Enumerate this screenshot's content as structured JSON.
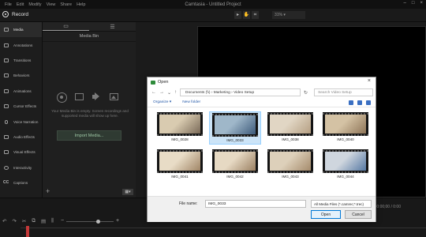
{
  "menubar": {
    "items": [
      "File",
      "Edit",
      "Modify",
      "View",
      "Share",
      "Help"
    ],
    "title": "Camtasia - Untitled Project"
  },
  "recordbar": {
    "record_label": "Record",
    "zoom": "31%"
  },
  "sidebar": {
    "items": [
      {
        "label": "Media",
        "icon": "media-icon"
      },
      {
        "label": "Annotations",
        "icon": "annotations-icon"
      },
      {
        "label": "Transitions",
        "icon": "transitions-icon"
      },
      {
        "label": "Behaviors",
        "icon": "behaviors-icon"
      },
      {
        "label": "Animations",
        "icon": "animations-icon"
      },
      {
        "label": "Cursor Effects",
        "icon": "cursor-effects-icon"
      },
      {
        "label": "Voice Narration",
        "icon": "microphone-icon"
      },
      {
        "label": "Audio Effects",
        "icon": "audio-effects-icon"
      },
      {
        "label": "Visual Effects",
        "icon": "visual-effects-icon"
      },
      {
        "label": "Interactivity",
        "icon": "interactivity-icon"
      },
      {
        "label": "Captions",
        "icon": "captions-icon"
      }
    ]
  },
  "panel": {
    "title": "Media Bin",
    "empty_message": "Your Media Bin is empty. Screen recordings and supported media will show up here.",
    "import_label": "Import Media..."
  },
  "timeline": {
    "timecode": "0:00:00;00 / 0:00"
  },
  "dialog": {
    "title": "Open",
    "address": "Documents (\\\\) › Marketing › Video Setup",
    "search_placeholder": "Search Video Setup",
    "organize_label": "Organize ▾",
    "new_folder_label": "New folder",
    "files": [
      {
        "name": "IMG_0028",
        "c1": "#d9cbb0",
        "c2": "#7a6a58",
        "selected": false
      },
      {
        "name": "IMG_0033",
        "c1": "#9fb7c9",
        "c2": "#3d5a7a",
        "selected": true
      },
      {
        "name": "IMG_0038",
        "c1": "#e1d6c4",
        "c2": "#b59f83",
        "selected": false
      },
      {
        "name": "IMG_0040",
        "c1": "#d4c2a4",
        "c2": "#8e7558",
        "selected": false
      },
      {
        "name": "IMG_0041",
        "c1": "#e8dcc6",
        "c2": "#a08566",
        "selected": false
      },
      {
        "name": "IMG_0042",
        "c1": "#e6d9c3",
        "c2": "#9b8062",
        "selected": false
      },
      {
        "name": "IMG_0043",
        "c1": "#ddd0ba",
        "c2": "#a58b6c",
        "selected": false
      },
      {
        "name": "IMG_0044",
        "c1": "#cfd6de",
        "c2": "#5679a3",
        "selected": false
      }
    ],
    "filename_label": "File name:",
    "filename_value": "IMG_0033",
    "filetype_value": "All Media Files (*.camrec;*.trec)",
    "open_label": "Open",
    "cancel_label": "Cancel"
  }
}
